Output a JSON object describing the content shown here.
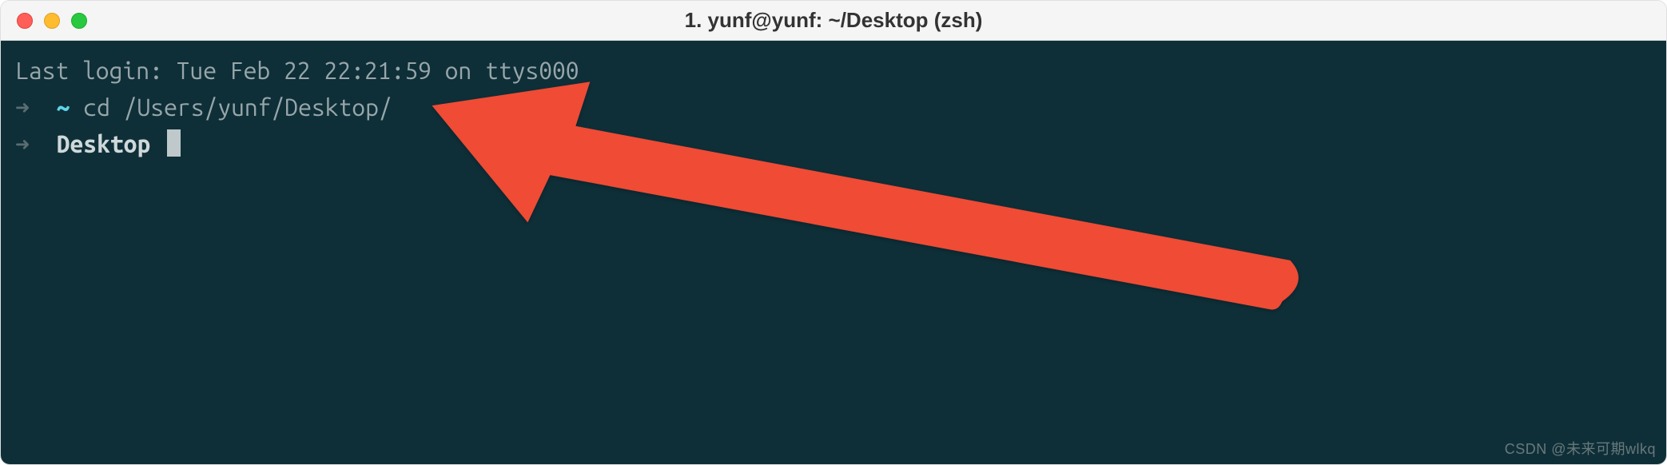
{
  "titlebar": {
    "title": "1. yunf@yunf: ~/Desktop (zsh)"
  },
  "terminal": {
    "lastlogin": "Last login: Tue Feb 22 22:21:59 on ttys000",
    "line1": {
      "arrow": "➜",
      "path": "~",
      "cmd": "cd /Users/yunf/Desktop/"
    },
    "line2": {
      "arrow": "➜",
      "path": "Desktop"
    }
  },
  "watermark": "CSDN @未来可期wlkq"
}
